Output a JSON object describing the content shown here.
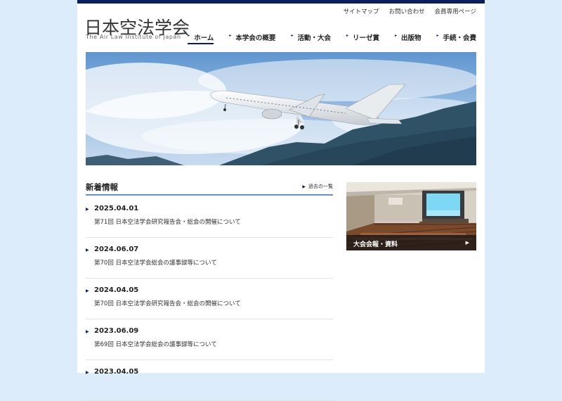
{
  "site": {
    "title_jp": "日本空法学会",
    "title_en": "The Air Law Institute of Japan"
  },
  "utility_nav": [
    {
      "label": "サイトマップ"
    },
    {
      "label": "お問い合わせ"
    },
    {
      "label": "会員専用ページ"
    }
  ],
  "global_nav": [
    {
      "label": "ホーム",
      "active": true
    },
    {
      "label": "本学会の概要"
    },
    {
      "label": "活動・大会"
    },
    {
      "label": "リーゼ賞"
    },
    {
      "label": "出版物"
    },
    {
      "label": "手続・会費"
    }
  ],
  "news": {
    "heading": "新着情報",
    "more_label": "過去の一覧",
    "items": [
      {
        "date": "2025.04.01",
        "text": "第71回 日本空法学会研究報告会・総会の開催について"
      },
      {
        "date": "2024.06.07",
        "text": "第70回 日本空法学会総会の議事録等について"
      },
      {
        "date": "2024.04.05",
        "text": "第70回 日本空法学会研究報告会・総会の開催について"
      },
      {
        "date": "2023.06.09",
        "text": "第69回 日本空法学会総会の議事録等について"
      },
      {
        "date": "2023.04.05",
        "text": ""
      }
    ]
  },
  "banner": {
    "label": "大会会報・資料"
  },
  "colors": {
    "navy": "#0b1d5a",
    "background": "#dcecfb",
    "rule": "#6d8fc7"
  }
}
